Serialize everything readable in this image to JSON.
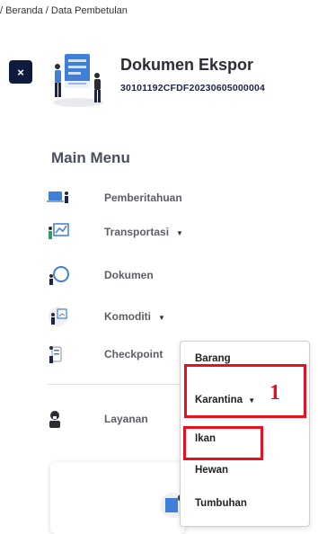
{
  "breadcrumb": "/ Beranda / Data Pembetulan",
  "close_button": {
    "label": "×"
  },
  "document": {
    "title": "Dokumen Ekspor",
    "id": "30101192CFDF20230605000004"
  },
  "main_menu": {
    "title": "Main Menu",
    "items": [
      {
        "label": "Pemberitahuan",
        "icon": "laptop-person-icon"
      },
      {
        "label": "Transportasi",
        "icon": "chart-board-icon",
        "caret": "▼"
      },
      {
        "label": "Dokumen",
        "icon": "document-person-icon"
      },
      {
        "label": "Komoditi",
        "icon": "presentation-icon",
        "caret": "▼"
      },
      {
        "label": "Checkpoint",
        "icon": "checkpoint-person-icon"
      },
      {
        "label": "Layanan",
        "icon": "support-agent-icon"
      }
    ]
  },
  "dropdown": {
    "items": [
      "Barang",
      "Karantina",
      "Ikan",
      "Hewan",
      "Tumbuhan"
    ],
    "karantina_caret": "▼"
  },
  "annotation": {
    "marker": "1",
    "color": "#e8101f"
  },
  "colors": {
    "dark_navy": "#0f1b3d",
    "id_text": "#1b2450",
    "menu_text": "#5b5e66"
  }
}
